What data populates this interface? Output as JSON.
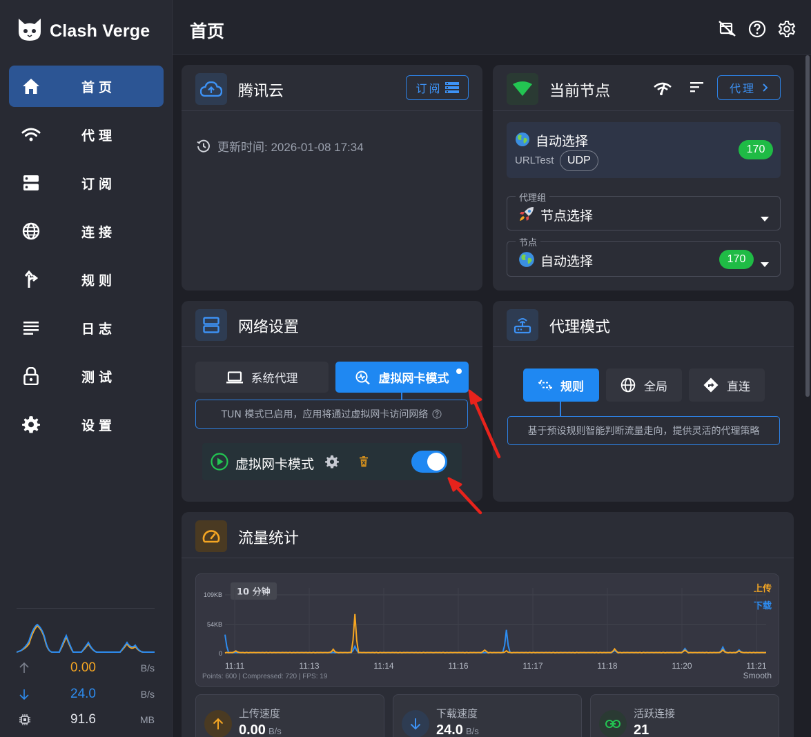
{
  "app": {
    "name": "Clash Verge"
  },
  "sidebar": {
    "items": [
      {
        "label": "首页",
        "icon": "home-icon",
        "active": true
      },
      {
        "label": "代理",
        "icon": "wifi-icon",
        "active": false
      },
      {
        "label": "订阅",
        "icon": "server-icon",
        "active": false
      },
      {
        "label": "连接",
        "icon": "globe-icon",
        "active": false
      },
      {
        "label": "规则",
        "icon": "fork-icon",
        "active": false
      },
      {
        "label": "日志",
        "icon": "list-icon",
        "active": false
      },
      {
        "label": "测试",
        "icon": "lock-icon",
        "active": false
      },
      {
        "label": "设置",
        "icon": "gear-icon",
        "active": false
      }
    ],
    "traffic": {
      "upload": {
        "value": "0.00",
        "unit": "B/s"
      },
      "download": {
        "value": "24.0",
        "unit": "B/s"
      },
      "memory": {
        "value": "91.6",
        "unit": "MB"
      }
    }
  },
  "header": {
    "title": "首页"
  },
  "profile_card": {
    "title": "腾讯云",
    "subscribe_button": "订阅",
    "update_label": "更新时间: 2026-01-08 17:34"
  },
  "node_card": {
    "title": "当前节点",
    "proxy_button": "代理",
    "current": {
      "name": "自动选择",
      "type": "URLTest",
      "udp_tag": "UDP",
      "delay": "170"
    },
    "group_legend": "代理组",
    "group_value": "节点选择",
    "node_legend": "节点",
    "node_value": "自动选择",
    "node_delay": "170"
  },
  "network_card": {
    "title": "网络设置",
    "system_proxy_label": "系统代理",
    "tun_label": "虚拟网卡模式",
    "tun_info": "TUN 模式已启用，应用将通过虚拟网卡访问网络",
    "tun_row_label": "虚拟网卡模式",
    "tun_enabled": true
  },
  "mode_card": {
    "title": "代理模式",
    "modes": [
      {
        "label": "规则",
        "active": true
      },
      {
        "label": "全局",
        "active": false
      },
      {
        "label": "直连",
        "active": false
      }
    ],
    "description": "基于预设规则智能判断流量走向，提供灵活的代理策略"
  },
  "traffic_card": {
    "title": "流量统计",
    "range_label": "10 分钟",
    "legend_upload": "上传",
    "legend_download": "下载",
    "footer_info": "Points: 600 | Compressed: 720 | FPS: 19",
    "smooth_label": "Smooth",
    "stats": [
      {
        "label": "上传速度",
        "value": "0.00",
        "unit": "B/s"
      },
      {
        "label": "下载速度",
        "value": "24.0",
        "unit": "B/s"
      },
      {
        "label": "活跃连接",
        "value": "21",
        "unit": ""
      }
    ],
    "colors": {
      "upload": "#f5a623",
      "download": "#2d8cf0"
    }
  },
  "chart_data": {
    "type": "line",
    "y_ticks": [
      "109KB",
      "54KB",
      "0"
    ],
    "x_ticks": [
      "11:11",
      "11:13",
      "11:14",
      "11:16",
      "11:17",
      "11:18",
      "11:20",
      "11:21"
    ],
    "ylim": [
      0,
      109
    ],
    "series": [
      {
        "name": "上传",
        "peaks": [
          [
            0.02,
            3
          ],
          [
            0.2,
            6
          ],
          [
            0.24,
            72
          ],
          [
            0.48,
            5
          ],
          [
            0.52,
            3
          ],
          [
            0.72,
            7
          ],
          [
            0.85,
            5
          ],
          [
            0.92,
            5
          ],
          [
            0.95,
            3
          ]
        ]
      },
      {
        "name": "下载",
        "peaks": [
          [
            0.0,
            34
          ],
          [
            0.24,
            12
          ],
          [
            0.52,
            42
          ],
          [
            0.72,
            4
          ],
          [
            0.85,
            8
          ],
          [
            0.92,
            10
          ],
          [
            0.95,
            5
          ]
        ]
      }
    ]
  }
}
